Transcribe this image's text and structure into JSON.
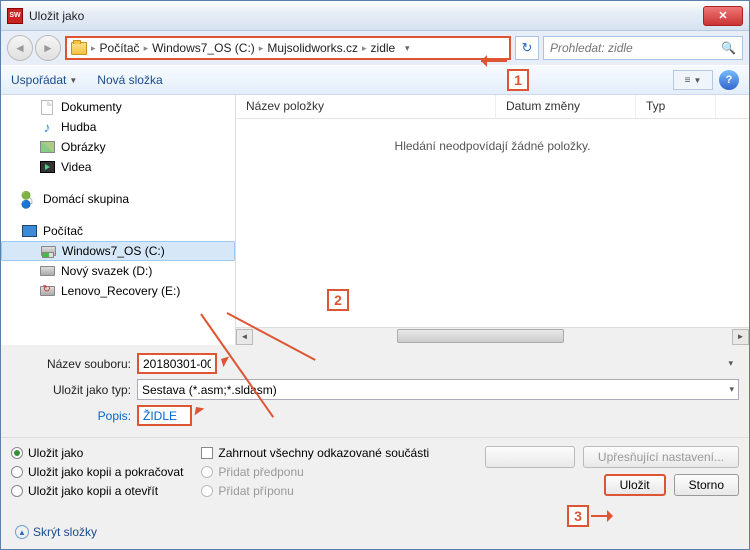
{
  "window": {
    "title": "Uložit jako"
  },
  "breadcrumb": {
    "items": [
      "Počítač",
      "Windows7_OS (C:)",
      "Mujsolidworks.cz",
      "zidle"
    ]
  },
  "search": {
    "placeholder": "Prohledat: zidle"
  },
  "toolbar": {
    "organize": "Uspořádat",
    "newfolder": "Nová složka"
  },
  "columns": {
    "name": "Název položky",
    "date": "Datum změny",
    "type": "Typ"
  },
  "empty_msg": "Hledání neodpovídají žádné položky.",
  "sidebar": {
    "libs": [
      "Dokumenty",
      "Hudba",
      "Obrázky",
      "Videa"
    ],
    "homegroup": "Domácí skupina",
    "computer": "Počítač",
    "drives": [
      "Windows7_OS (C:)",
      "Nový svazek (D:)",
      "Lenovo_Recovery (E:)"
    ]
  },
  "form": {
    "filename_label": "Název souboru:",
    "filename_value": "20180301-00",
    "filetype_label": "Uložit jako typ:",
    "filetype_value": "Sestava (*.asm;*.sldasm)",
    "desc_label": "Popis:",
    "desc_value": "ŽIDLE"
  },
  "options": {
    "save_as": "Uložit jako",
    "save_copy_continue": "Uložit jako kopii a pokračovat",
    "save_copy_open": "Uložit jako kopii a otevřít",
    "include_refs": "Zahrnout všechny odkazované součásti",
    "add_prefix": "Přidat předponu",
    "add_suffix": "Přidat příponu",
    "advanced": "Upřesňující nastavení...",
    "hide_folders": "Skrýt složky"
  },
  "buttons": {
    "save": "Uložit",
    "cancel": "Storno"
  },
  "callouts": {
    "c1": "1",
    "c2": "2",
    "c3": "3"
  }
}
